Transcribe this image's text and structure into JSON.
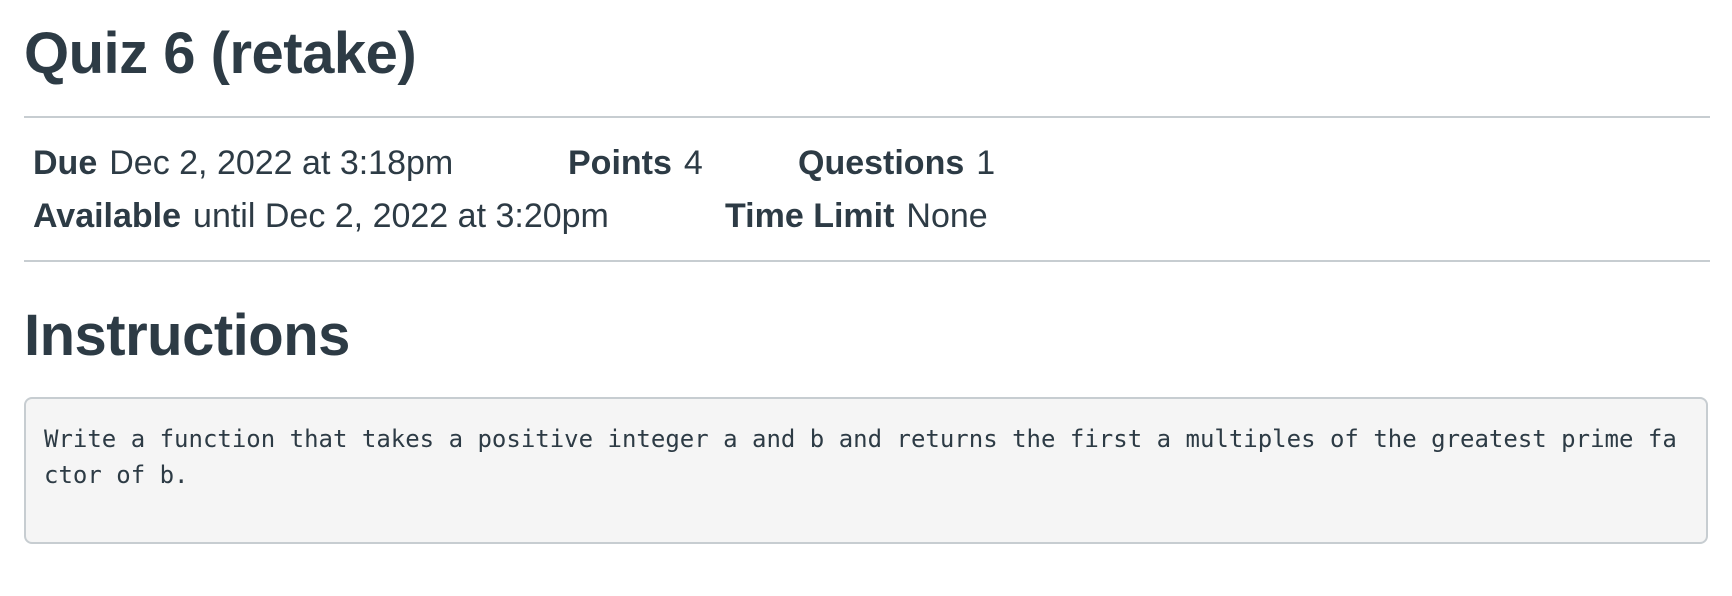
{
  "quiz": {
    "title": "Quiz 6 (retake)"
  },
  "details": {
    "due_label": "Due",
    "due_value": "Dec 2, 2022 at 3:18pm",
    "points_label": "Points",
    "points_value": "4",
    "questions_label": "Questions",
    "questions_value": "1",
    "available_label": "Available",
    "available_value": "until Dec 2, 2022 at 3:20pm",
    "time_limit_label": "Time Limit",
    "time_limit_value": "None"
  },
  "instructions": {
    "heading": "Instructions",
    "body": "Write a function that takes a positive integer a and b and returns the first a multiples of the greatest prime factor of b."
  }
}
